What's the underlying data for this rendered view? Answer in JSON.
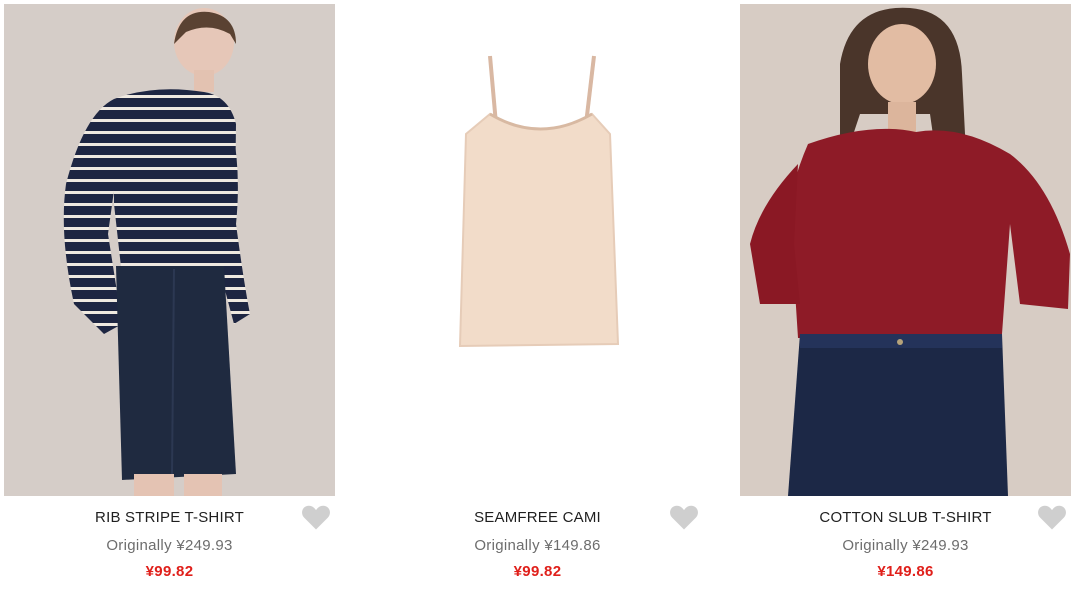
{
  "products": [
    {
      "name": "RIB STRIPE T-SHIRT",
      "original_price": "Originally ¥249.93",
      "sale_price": "¥99.82",
      "image": "woman in navy and white striped long-sleeve top with dark denim skirt"
    },
    {
      "name": "SEAMFREE CAMI",
      "original_price": "Originally ¥149.86",
      "sale_price": "¥99.82",
      "image": "nude seamfree camisole"
    },
    {
      "name": "COTTON SLUB T-SHIRT",
      "original_price": "Originally ¥249.93",
      "sale_price": "¥149.86",
      "image": "woman in burgundy long-sleeve top with dark jeans"
    }
  ],
  "icons": {
    "wishlist": "heart-icon"
  },
  "colors": {
    "sale": "#e0201b",
    "original": "#6d6d6d",
    "name": "#1f1f1f",
    "heart": "#cfcfcf"
  }
}
